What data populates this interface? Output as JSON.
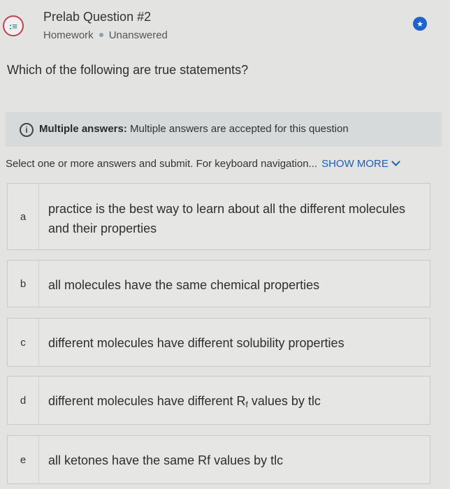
{
  "header": {
    "title": "Prelab Question #2",
    "category": "Homework",
    "status": "Unanswered",
    "icon": "question-list-icon"
  },
  "prompt": "Which of the following are true statements?",
  "info": {
    "label": "Multiple answers:",
    "text": "Multiple answers are accepted for this question"
  },
  "instructions": {
    "text": "Select one or more answers and submit. For keyboard navigation...",
    "show_more": "SHOW MORE"
  },
  "options": [
    {
      "letter": "a",
      "text": "practice is the best way to learn about all the different molecules and their properties"
    },
    {
      "letter": "b",
      "text": "all molecules have the same chemical properties"
    },
    {
      "letter": "c",
      "text": "different molecules have different solubility properties"
    },
    {
      "letter": "d",
      "text_prefix": "different molecules have different R",
      "subscript": "f",
      "text_suffix": " values by tlc"
    },
    {
      "letter": "e",
      "text": "all ketones have the same Rf values by tlc"
    }
  ],
  "colors": {
    "accent": "#1d5fb8",
    "bookmark": "#1f63c9"
  }
}
